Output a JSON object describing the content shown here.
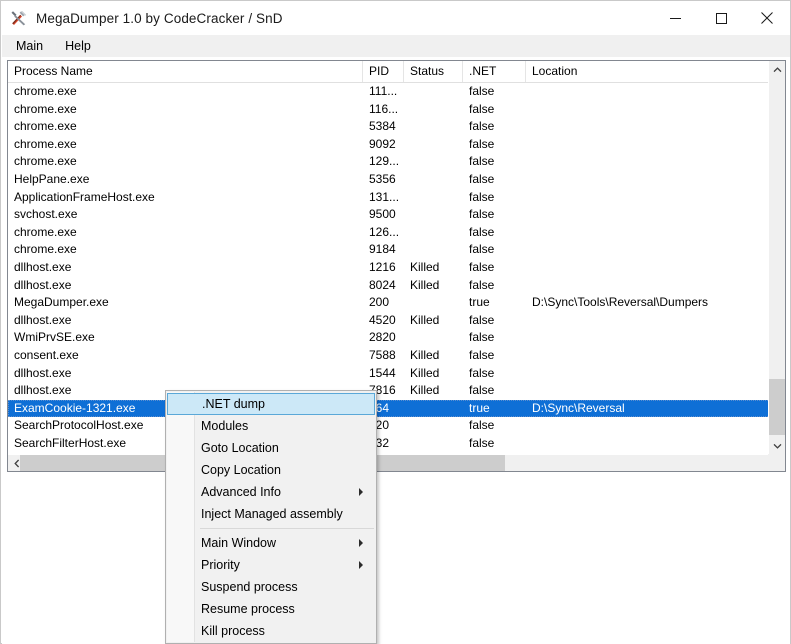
{
  "window": {
    "title": "MegaDumper 1.0 by CodeCracker / SnD",
    "icon": "tools-icon",
    "caption": {
      "minimize": "minimize-icon",
      "maximize": "maximize-icon",
      "close": "close-icon"
    }
  },
  "menubar": {
    "items": [
      {
        "label": "Main"
      },
      {
        "label": "Help"
      }
    ]
  },
  "list": {
    "columns": [
      {
        "key": "name",
        "label": "Process Name"
      },
      {
        "key": "pid",
        "label": "PID"
      },
      {
        "key": "status",
        "label": "Status"
      },
      {
        "key": "net",
        "label": ".NET"
      },
      {
        "key": "location",
        "label": "Location"
      }
    ],
    "rows": [
      {
        "name": "chrome.exe",
        "pid": "111...",
        "status": "",
        "net": "false",
        "location": ""
      },
      {
        "name": "chrome.exe",
        "pid": "116...",
        "status": "",
        "net": "false",
        "location": ""
      },
      {
        "name": "chrome.exe",
        "pid": "5384",
        "status": "",
        "net": "false",
        "location": ""
      },
      {
        "name": "chrome.exe",
        "pid": "9092",
        "status": "",
        "net": "false",
        "location": ""
      },
      {
        "name": "chrome.exe",
        "pid": "129...",
        "status": "",
        "net": "false",
        "location": ""
      },
      {
        "name": "HelpPane.exe",
        "pid": "5356",
        "status": "",
        "net": "false",
        "location": ""
      },
      {
        "name": "ApplicationFrameHost.exe",
        "pid": "131...",
        "status": "",
        "net": "false",
        "location": ""
      },
      {
        "name": "svchost.exe",
        "pid": "9500",
        "status": "",
        "net": "false",
        "location": ""
      },
      {
        "name": "chrome.exe",
        "pid": "126...",
        "status": "",
        "net": "false",
        "location": ""
      },
      {
        "name": "chrome.exe",
        "pid": "9184",
        "status": "",
        "net": "false",
        "location": ""
      },
      {
        "name": "dllhost.exe",
        "pid": "1216",
        "status": "Killed",
        "net": "false",
        "location": ""
      },
      {
        "name": "dllhost.exe",
        "pid": "8024",
        "status": "Killed",
        "net": "false",
        "location": ""
      },
      {
        "name": "MegaDumper.exe",
        "pid": "200",
        "status": "",
        "net": "true",
        "location": "D:\\Sync\\Tools\\Reversal\\Dumpers"
      },
      {
        "name": "dllhost.exe",
        "pid": "4520",
        "status": "Killed",
        "net": "false",
        "location": ""
      },
      {
        "name": "WmiPrvSE.exe",
        "pid": "2820",
        "status": "",
        "net": "false",
        "location": ""
      },
      {
        "name": "consent.exe",
        "pid": "7588",
        "status": "Killed",
        "net": "false",
        "location": ""
      },
      {
        "name": "dllhost.exe",
        "pid": "1544",
        "status": "Killed",
        "net": "false",
        "location": ""
      },
      {
        "name": "dllhost.exe",
        "pid": "7816",
        "status": "Killed",
        "net": "false",
        "location": ""
      },
      {
        "name": "ExamCookie-1321.exe",
        "pid": "364",
        "status": "",
        "net": "true",
        "location": "D:\\Sync\\Reversal",
        "selected": true
      },
      {
        "name": "SearchProtocolHost.exe",
        "pid": "720",
        "status": "",
        "net": "false",
        "location": ""
      },
      {
        "name": "SearchFilterHost.exe",
        "pid": "732",
        "status": "",
        "net": "false",
        "location": ""
      }
    ],
    "scrollbars": {
      "vertical_up": "chevron-up-icon",
      "vertical_down": "chevron-down-icon",
      "horizontal_left": "chevron-left-icon",
      "horizontal_right": "chevron-right-icon"
    }
  },
  "context_menu": {
    "items": [
      {
        "label": ".NET dump",
        "highlighted": true
      },
      {
        "label": "Modules"
      },
      {
        "label": "Goto Location"
      },
      {
        "label": "Copy Location"
      },
      {
        "label": "Advanced Info",
        "submenu": true
      },
      {
        "label": "Inject Managed assembly"
      },
      {
        "separator": true
      },
      {
        "label": "Main Window",
        "submenu": true
      },
      {
        "label": "Priority",
        "submenu": true
      },
      {
        "label": "Suspend process"
      },
      {
        "label": "Resume process"
      },
      {
        "label": "Kill process"
      }
    ]
  },
  "colors": {
    "selection": "#0e6fd6",
    "menu_highlight_fill": "#cce8f7",
    "menu_highlight_border": "#5aa8d8",
    "scrollbar_thumb": "#cdcdcd",
    "window_border": "#c9c9c9"
  }
}
